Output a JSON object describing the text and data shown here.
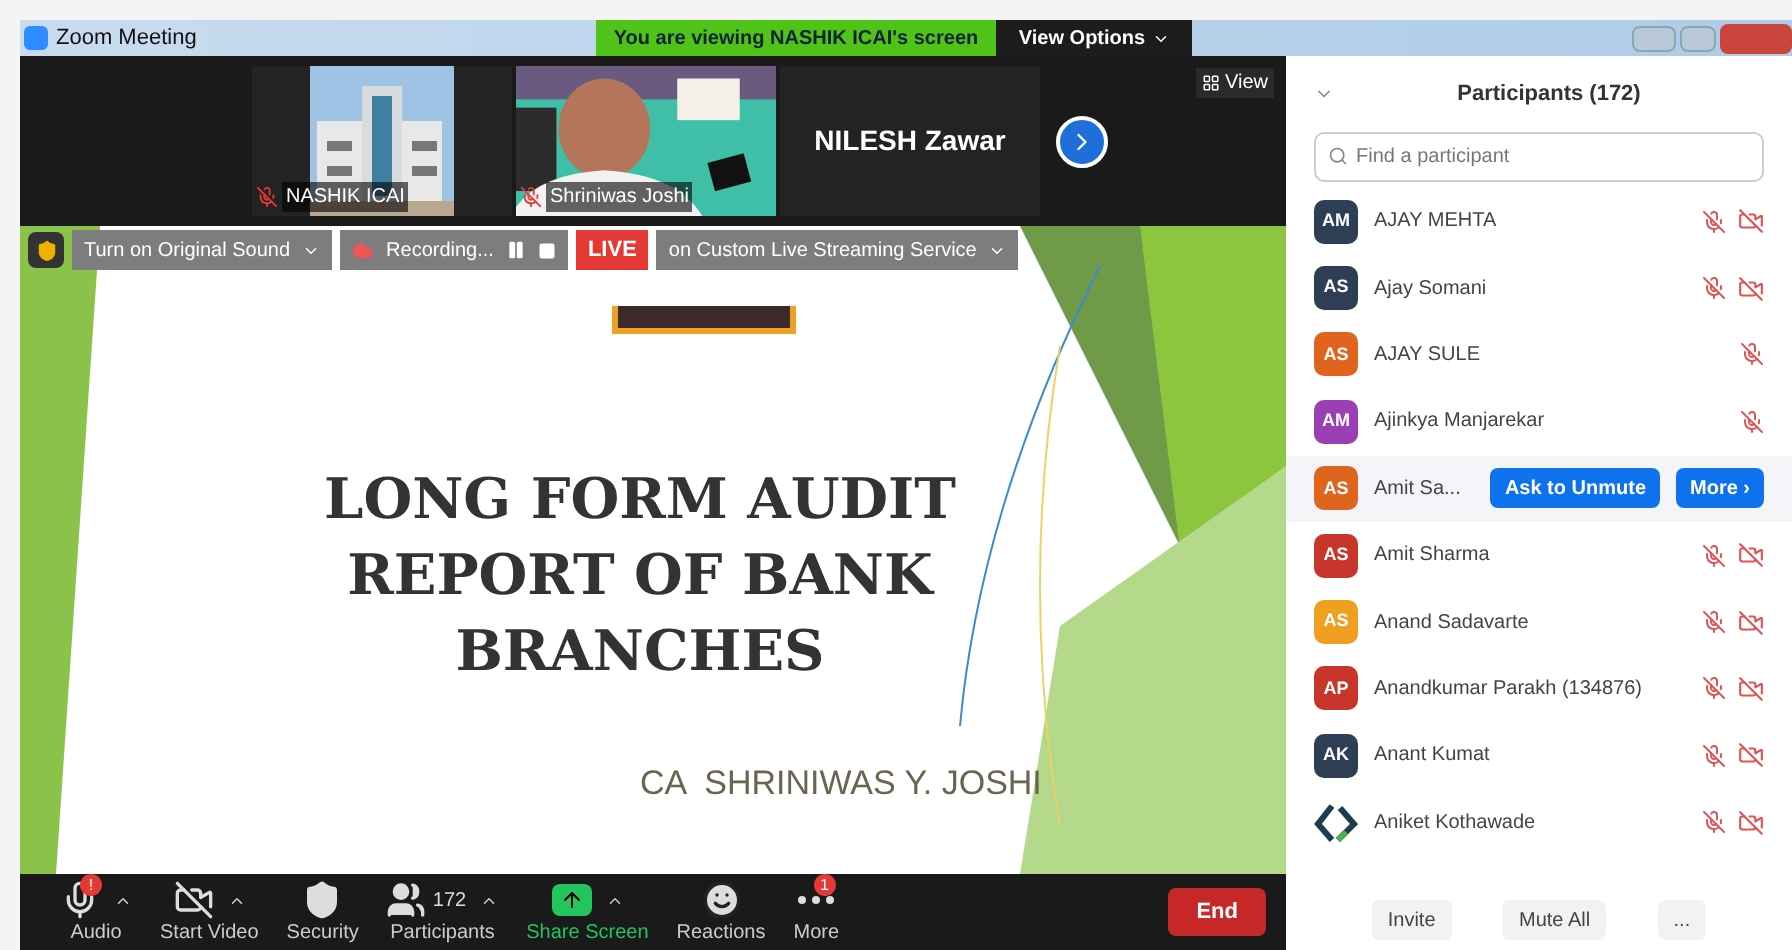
{
  "window": {
    "title": "Zoom Meeting",
    "banner": "You are viewing NASHIK ICAI's screen",
    "view_options": "View Options"
  },
  "video_strip": {
    "tiles": [
      {
        "kind": "building",
        "name": "NASHIK ICAI",
        "muted": true
      },
      {
        "kind": "person",
        "name": "Shriniwas Joshi",
        "muted": true
      },
      {
        "kind": "name",
        "name": "NILESH Zawar",
        "muted": false
      }
    ],
    "view_button": "View"
  },
  "meeting_toolbar": {
    "original_sound": "Turn on Original Sound",
    "recording": "Recording...",
    "live": "LIVE",
    "streaming": "on Custom Live Streaming Service"
  },
  "slide": {
    "title_lines": [
      "LONG FORM AUDIT",
      "REPORT OF BANK",
      "BRANCHES"
    ],
    "author": "CA  SHRINIWAS Y. JOSHI"
  },
  "bottom_bar": {
    "items": [
      {
        "kind": "audio",
        "label": "Audio",
        "badge": "!",
        "caret": true,
        "highlight": false
      },
      {
        "kind": "video",
        "label": "Start Video",
        "caret": true,
        "highlight": false
      },
      {
        "kind": "security",
        "label": "Security",
        "caret": false,
        "highlight": false
      },
      {
        "kind": "participants",
        "label": "Participants",
        "count": "172",
        "caret": true,
        "highlight": false
      },
      {
        "kind": "share",
        "label": "Share Screen",
        "caret": true,
        "highlight": true
      },
      {
        "kind": "reactions",
        "label": "Reactions",
        "caret": false,
        "highlight": false
      },
      {
        "kind": "more",
        "label": "More",
        "badge": "1",
        "caret": false,
        "highlight": false
      }
    ],
    "end": "End"
  },
  "participants": {
    "title": "Participants (172)",
    "search": {
      "placeholder": "Find a participant"
    },
    "items": [
      {
        "initials": "AM",
        "name": "AJAY MEHTA",
        "color": "#2d3e55",
        "mic_muted": true,
        "video_off": true,
        "hovered": false
      },
      {
        "initials": "AS",
        "name": "Ajay Somani",
        "color": "#2d3e55",
        "mic_muted": true,
        "video_off": true,
        "hovered": false
      },
      {
        "initials": "AS",
        "name": "AJAY SULE",
        "color": "#e0641e",
        "mic_muted": true,
        "video_off": false,
        "hovered": false
      },
      {
        "initials": "AM",
        "name": "Ajinkya Manjarekar",
        "color": "#9b3fb5",
        "mic_muted": true,
        "video_off": false,
        "hovered": false
      },
      {
        "initials": "AS",
        "name": "Amit Sa...",
        "color": "#e0641e",
        "hovered": true,
        "actions": [
          "Ask to Unmute",
          "More ›"
        ]
      },
      {
        "initials": "AS",
        "name": "Amit Sharma",
        "color": "#c8352b",
        "mic_muted": true,
        "video_off": true,
        "hovered": false
      },
      {
        "initials": "AS",
        "name": "Anand Sadavarte",
        "color": "#f0a020",
        "mic_muted": true,
        "video_off": true,
        "hovered": false
      },
      {
        "initials": "AP",
        "name": "Anandkumar Parakh (134876)",
        "color": "#c8352b",
        "mic_muted": true,
        "video_off": true,
        "hovered": false
      },
      {
        "initials": "AK",
        "name": "Anant Kumat",
        "color": "#2d3e55",
        "mic_muted": true,
        "video_off": true,
        "hovered": false
      },
      {
        "kind": "logo",
        "name": "Aniket Kothawade",
        "mic_muted": true,
        "video_off": true,
        "hovered": false
      }
    ],
    "footer": [
      "Invite",
      "Mute All",
      "..."
    ]
  }
}
